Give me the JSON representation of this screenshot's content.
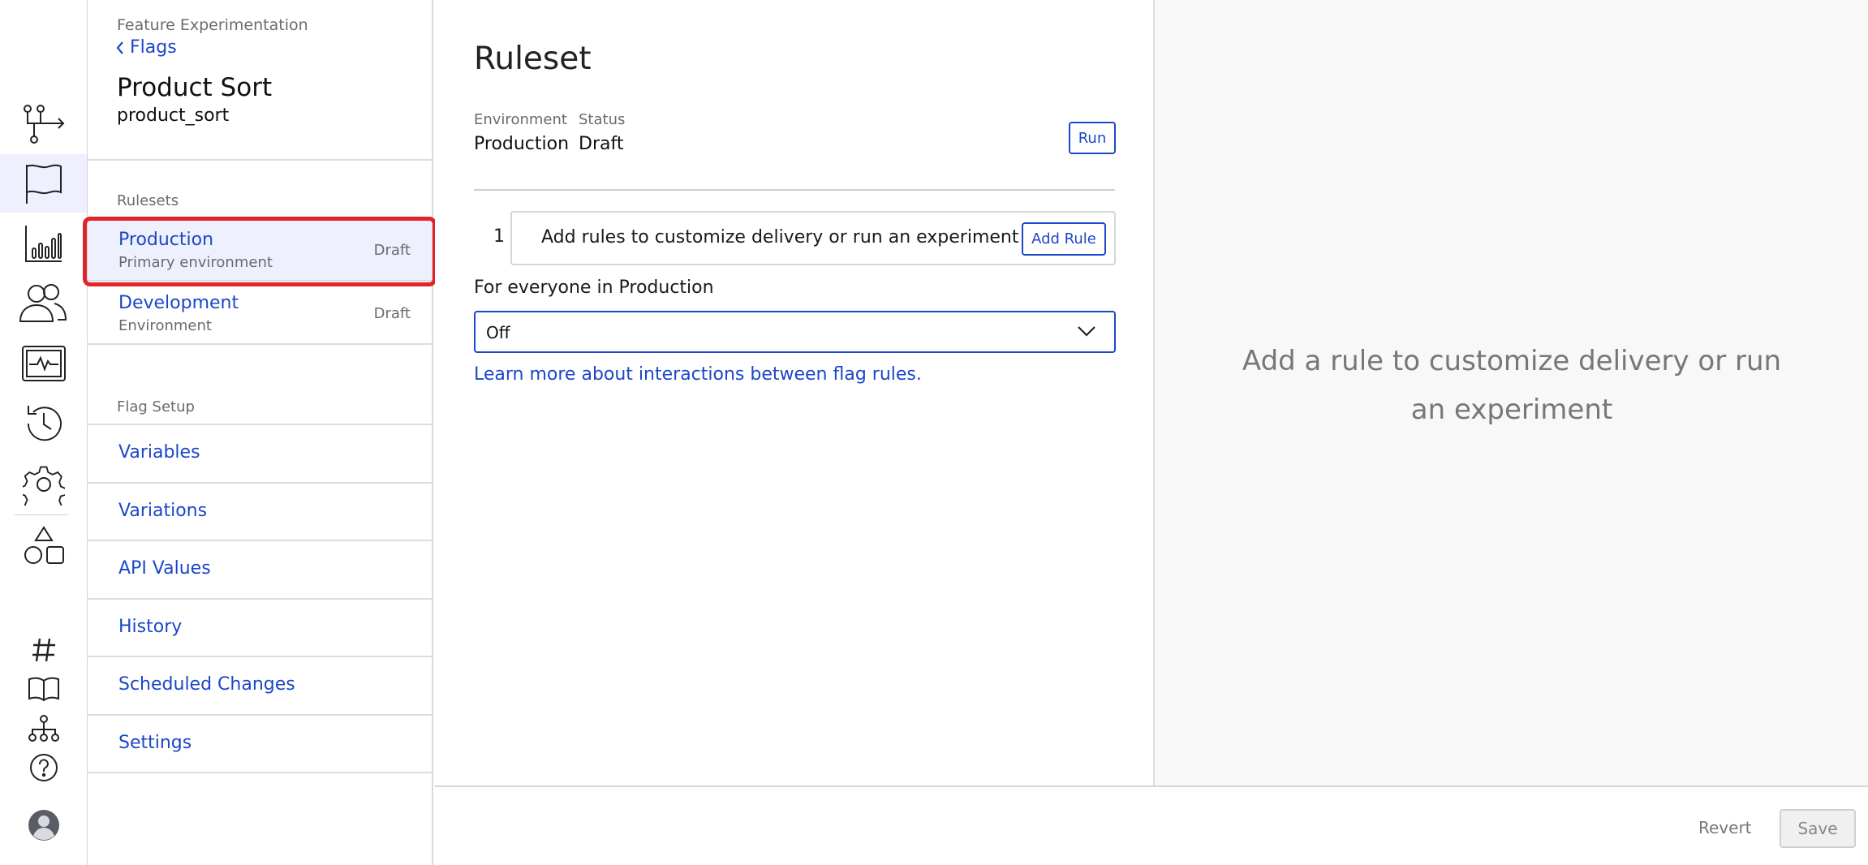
{
  "rail": {
    "items": [
      {
        "icon": "workflow-icon"
      },
      {
        "icon": "flag-icon",
        "active": true
      },
      {
        "icon": "bar-chart-icon"
      },
      {
        "icon": "users-icon"
      },
      {
        "icon": "monitor-pulse-icon"
      },
      {
        "icon": "history-icon"
      },
      {
        "icon": "gear-icon"
      },
      {
        "icon": "shapes-icon"
      },
      {
        "icon": "hash-icon"
      },
      {
        "icon": "book-icon"
      },
      {
        "icon": "hierarchy-icon"
      },
      {
        "icon": "help-icon"
      },
      {
        "icon": "avatar-icon"
      }
    ]
  },
  "nav": {
    "crumb": "Feature Experimentation",
    "back_label": "Flags",
    "flag_title": "Product Sort",
    "flag_key": "product_sort",
    "rulesets_label": "Rulesets",
    "environments": [
      {
        "name": "Production",
        "sub": "Primary environment",
        "status": "Draft",
        "selected": true
      },
      {
        "name": "Development",
        "sub": "Environment",
        "status": "Draft",
        "selected": false
      }
    ],
    "setup_label": "Flag Setup",
    "setup_items": [
      "Variables",
      "Variations",
      "API Values",
      "History",
      "Scheduled Changes",
      "Settings"
    ]
  },
  "main": {
    "title": "Ruleset",
    "env_label": "Environment",
    "env_value": "Production",
    "status_label": "Status",
    "status_value": "Draft",
    "run_label": "Run",
    "rule_number": "1",
    "rule_text": "Add rules to customize delivery or run an experiment",
    "add_rule_label": "Add Rule",
    "everyone_label": "For everyone in Production",
    "select_value": "Off",
    "learn_link": "Learn more about interactions between flag rules."
  },
  "right": {
    "empty_message": "Add a rule to customize delivery or run an experiment"
  },
  "footer": {
    "revert_label": "Revert",
    "save_label": "Save"
  },
  "colors": {
    "accent": "#1c47c8",
    "highlight": "#e0242c",
    "selected_bg": "#eef0fd"
  }
}
